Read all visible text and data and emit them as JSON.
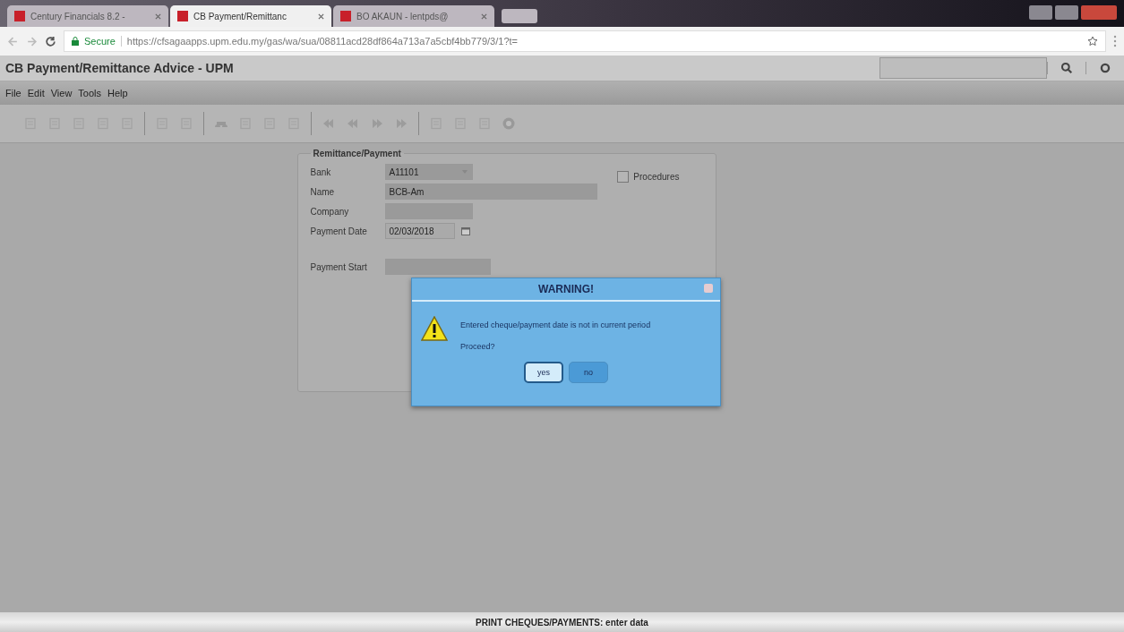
{
  "browser": {
    "tabs": [
      {
        "label": "Century Financials 8.2 -",
        "selected": false
      },
      {
        "label": "CB Payment/Remittanc",
        "selected": true
      },
      {
        "label": "BO AKAUN - lentpds@",
        "selected": false
      }
    ],
    "security": "Secure",
    "url": "https://cfsagaapps.upm.edu.my/gas/wa/sua/08811acd28df864a713a7a5cbf4bb779/3/1?t="
  },
  "window": {
    "title": "CB Payment/Remittance Advice - UPM"
  },
  "menu": [
    "File",
    "Edit",
    "View",
    "Tools",
    "Help"
  ],
  "form": {
    "legend": "Remittance/Payment",
    "fields": [
      {
        "label": "Bank",
        "value": "A11101",
        "kind": "lookup"
      },
      {
        "label": "Name",
        "value": "BCB-Am",
        "kind": "wide"
      },
      {
        "label": "Company",
        "kind": "plain"
      },
      {
        "label": "Payment Date",
        "value": "02/03/2018",
        "kind": "date"
      },
      {
        "label": "Payment Start",
        "kind": "plain"
      }
    ],
    "checkbox": {
      "label": "Procedures",
      "checked": false
    }
  },
  "dialog": {
    "title": "WARNING!",
    "message": "Entered cheque/payment date is not in current period",
    "question": "Proceed?",
    "buttons": [
      {
        "label": "yes",
        "selected": true
      },
      {
        "label": "no",
        "selected": false
      }
    ]
  },
  "status_bar": "PRINT CHEQUES/PAYMENTS: enter data"
}
